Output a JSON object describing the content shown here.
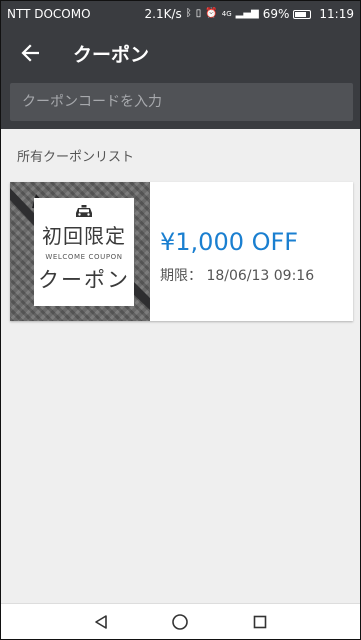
{
  "status_bar": {
    "carrier": "NTT DOCOMO",
    "speed": "2.1K/s",
    "network": "4G",
    "battery": "69%",
    "time": "11:19"
  },
  "toolbar": {
    "title": "クーポン"
  },
  "search": {
    "placeholder": "クーポンコードを入力"
  },
  "section": {
    "label": "所有クーポンリスト"
  },
  "coupon": {
    "image_title": "初回限定",
    "image_subtitle": "WELCOME COUPON",
    "image_bottom": "クーポン",
    "amount": "¥1,000 OFF",
    "expiry": "期限： 18/06/13 09:16"
  },
  "colors": {
    "accent": "#1a7fd0",
    "app_bar": "#3a3c40"
  }
}
